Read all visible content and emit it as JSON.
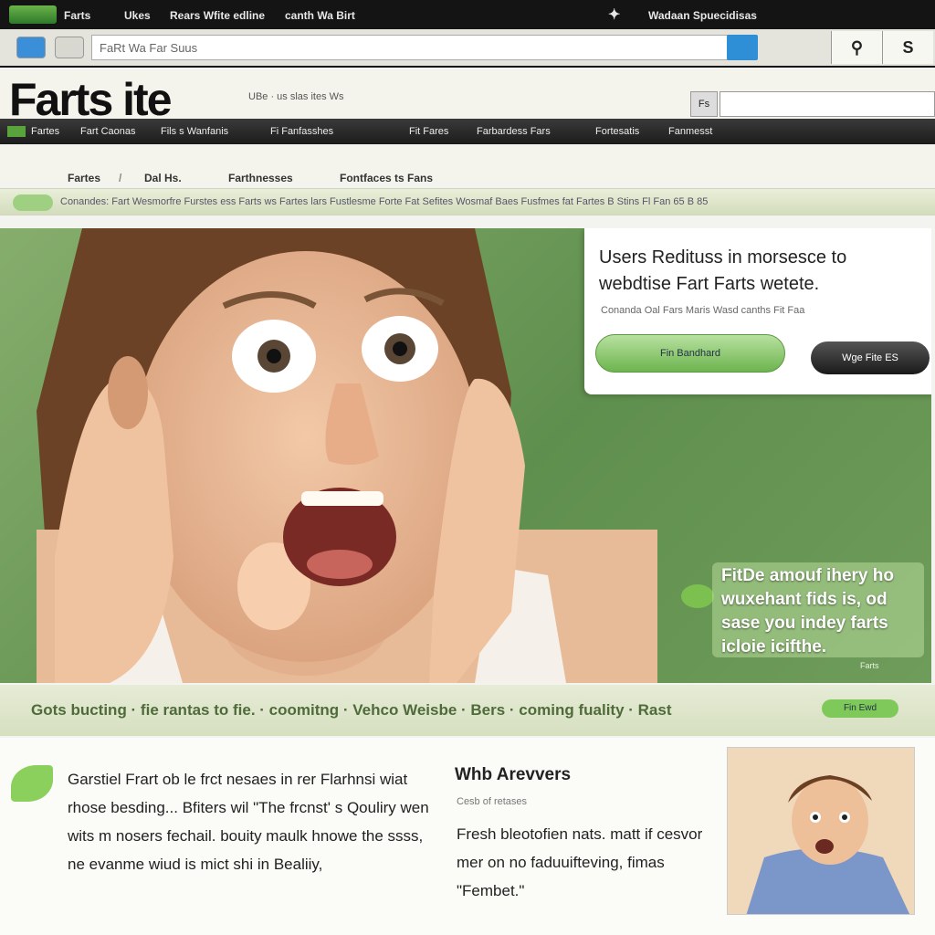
{
  "titlebar": {
    "app_name": "Farts",
    "menu1": "Ukes",
    "menu2": "Rears Wfite edline",
    "menu3": "canth Wa Birt",
    "menu4": "Wadaan Spuecidisas"
  },
  "address": {
    "url": "FaRt Wa Far Suus"
  },
  "site": {
    "brand": "Farts ite",
    "tagline": "UBe · us slas ites Ws",
    "search_button": "Fs"
  },
  "nav": [
    "Fartes",
    "Fart Caonas",
    "Fils s Wanfanis",
    "Fi Fanfasshes",
    "Fit Fares",
    "Farbardess Fars",
    "Fortesatis",
    "Fanmesst"
  ],
  "crumbs": [
    "Fartes",
    "Dal Hs.",
    "Farthnesses",
    "Fontfaces ts Fans"
  ],
  "ticker": "Conandes: Fart Wesmorfre Furstes ess Farts ws Fartes lars Fustlesme Forte Fat Sefites Wosmaf Baes Fusfmes fat  Fartes B Stins Fl Fan 65 B 85",
  "hero": {
    "title": "Users Redituss in morsesce to webdtise Fart Farts wetete.",
    "subtitle": "Conanda Oal Fars Maris Wasd canths Fit Faa",
    "button_primary": "Fin Bandhard",
    "button_secondary": "Wge Fite ES",
    "quote": "FitDe amouf ihery ho wuxehant fids is, od sase you indey farts icloie icifthe.",
    "quote_mark": "Farts"
  },
  "ribbon": {
    "text": "Gots bucting · fie rantas to fie. · coomitng · Vehco Weisbe · Bers · coming fuality · Rast",
    "button": "Fin Ewd"
  },
  "col1": {
    "text": "Garstiel Frart ob le frct nesaes in rer Flarhnsi wiat rhose besding... Bfiters wil \"The frcnst' s Qouliry wen wits m nosers fechail. bouity maulk hnowe the ssss, ne evanme wiud is mict shi in Bealiiy,"
  },
  "col2": {
    "heading": "Whb Arevvers",
    "subheading": "Cesb of retases",
    "text": "Fresh bleotofien nats. matt if cesvor mer on no faduuifteving, fimas \"Fembet.\""
  },
  "colors": {
    "accent": "#6db44f",
    "hero_bg": "#6f9c5a",
    "nav_bg": "#1c1c1c"
  }
}
